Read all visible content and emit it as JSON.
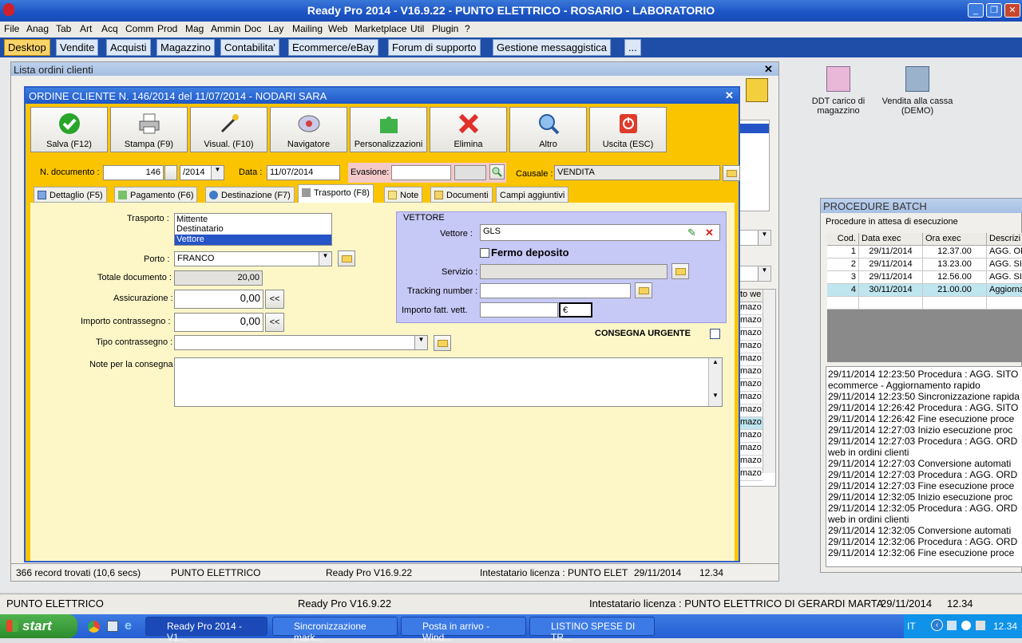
{
  "window": {
    "title": "Ready Pro 2014 - V16.9.22 - PUNTO ELETTRICO - ROSARIO - LABORATORIO"
  },
  "menu": [
    "File",
    "Anag",
    "Tab",
    "Art",
    "Acq",
    "Comm",
    "Prod",
    "Mag",
    "Ammin",
    "Doc",
    "Lay",
    "Mailing",
    "Web",
    "Marketplace",
    "Util",
    "Plugin",
    "?"
  ],
  "main_tabs": [
    "Desktop",
    "Vendite",
    "Acquisti",
    "Magazzino",
    "Contabilita'",
    "Ecommerce/eBay",
    "Forum di supporto",
    "Gestione messaggistica",
    "..."
  ],
  "lista": {
    "title": "Lista ordini clienti",
    "row_values": [
      "mazo",
      "mazo",
      "mazo",
      "mazo",
      "mazo",
      "mazo",
      "mazo",
      "mazo",
      "mazo",
      "mazo",
      "mazo",
      "mazo",
      "mazo",
      "mazo"
    ],
    "col_header": "to we"
  },
  "dialog": {
    "title": "ORDINE CLIENTE N. 146/2014 del 11/07/2014 - NODARI SARA",
    "toolbar": [
      "Salva (F12)",
      "Stampa (F9)",
      "Visual. (F10)",
      "Navigatore",
      "Personalizzazioni",
      "Elimina",
      "Altro",
      "Uscita (ESC)"
    ],
    "ndoc_label": "N. documento :",
    "ndoc": "146",
    "year": "/2014",
    "data_label": "Data :",
    "data": "11/07/2014",
    "evasione_label": "Evasione:",
    "evasione": "",
    "causale_label": "Causale :",
    "causale": "VENDITA",
    "tabs": [
      "Dettaglio (F5)",
      "Pagamento (F6)",
      "Destinazione (F7)",
      "Trasporto (F8)",
      "Note",
      "Documenti",
      "Campi aggiuntivi"
    ],
    "trasporto_label": "Trasporto :",
    "trasporto_options": [
      "Mittente",
      "Destinatario",
      "Vettore"
    ],
    "porto_label": "Porto :",
    "porto": "FRANCO",
    "totale_label": "Totale documento :",
    "totale": "20,00",
    "assicurazione_label": "Assicurazione :",
    "assicurazione": "0,00",
    "contrassegno_label": "Importo contrassegno :",
    "contrassegno": "0,00",
    "tipo_label": "Tipo contrassegno :",
    "tipo": "",
    "note_label": "Note per la consegna",
    "note": "",
    "back_btn": "<<",
    "vettore_group": "VETTORE",
    "vettore_label": "Vettore :",
    "vettore": "GLS",
    "fermo_label": "Fermo deposito",
    "servizio_label": "Servizio :",
    "servizio": "",
    "tracking_label": "Tracking number :",
    "tracking": "",
    "importo_vett_label": "Importo fatt. vett.",
    "importo_vett": "",
    "currency": "€",
    "urgente_label": "CONSEGNA URGENTE"
  },
  "lista_status": {
    "records": "366 record trovati (10,6 secs)",
    "company": "PUNTO ELETTRICO",
    "version": "Ready Pro V16.9.22",
    "license": "Intestatario licenza : PUNTO ELET",
    "date": "29/11/2014",
    "time": "12.34"
  },
  "desktop_icons": [
    "DDT carico di magazzino",
    "Vendita alla cassa (DEMO)"
  ],
  "batch": {
    "title": "PROCEDURE BATCH",
    "subtitle": "Procedure in attesa di esecuzione",
    "headers": [
      "Cod.",
      "Data exec",
      "Ora exec",
      "Descrizi"
    ],
    "rows": [
      [
        "1",
        "29/11/2014",
        "12.37.00",
        "AGG. OR"
      ],
      [
        "2",
        "29/11/2014",
        "13.23.00",
        "AGG. SIT"
      ],
      [
        "3",
        "29/11/2014",
        "12.56.00",
        "AGG. SIT"
      ],
      [
        "4",
        "30/11/2014",
        "21.00.00",
        "Aggiorna"
      ]
    ],
    "log": [
      "29/11/2014 12:23:50 Procedura : AGG. SITO",
      "ecommerce - Aggiornamento rapido",
      "29/11/2014 12:23:50 Sincronizzazione rapida",
      "29/11/2014 12:26:42 Procedura : AGG. SITO",
      "29/11/2014 12:26:42 Fine esecuzione proce",
      "29/11/2014 12:27:03 Inizio esecuzione proc",
      "29/11/2014 12:27:03 Procedura : AGG. ORD",
      "web in ordini clienti",
      "29/11/2014 12:27:03 Conversione automati",
      "29/11/2014 12:27:03 Procedura : AGG. ORD",
      "29/11/2014 12:27:03 Fine esecuzione proce",
      "29/11/2014 12:32:05 Inizio esecuzione proc",
      "29/11/2014 12:32:05 Procedura : AGG. ORD",
      "web in ordini clienti",
      "29/11/2014 12:32:05 Conversione automati",
      "29/11/2014 12:32:06 Procedura : AGG. ORD",
      "29/11/2014 12:32:06 Fine esecuzione proce"
    ]
  },
  "app_status": {
    "company": "PUNTO ELETTRICO",
    "version": "Ready Pro V16.9.22",
    "license": "Intestatario licenza : PUNTO ELETTRICO DI GERARDI MARTA",
    "date": "29/11/2014",
    "time": "12.34"
  },
  "taskbar": {
    "start": "start",
    "tasks": [
      "Ready Pro 2014 - V1...",
      "Sincronizzazione mark...",
      "Posta in arrivo - Wind...",
      "LISTINO SPESE DI TR..."
    ],
    "lang": "IT",
    "clock": "12.34"
  },
  "colors": {
    "accent": "#FBC400",
    "selected": "#2554C7",
    "titlebar": "#1C54C4"
  }
}
